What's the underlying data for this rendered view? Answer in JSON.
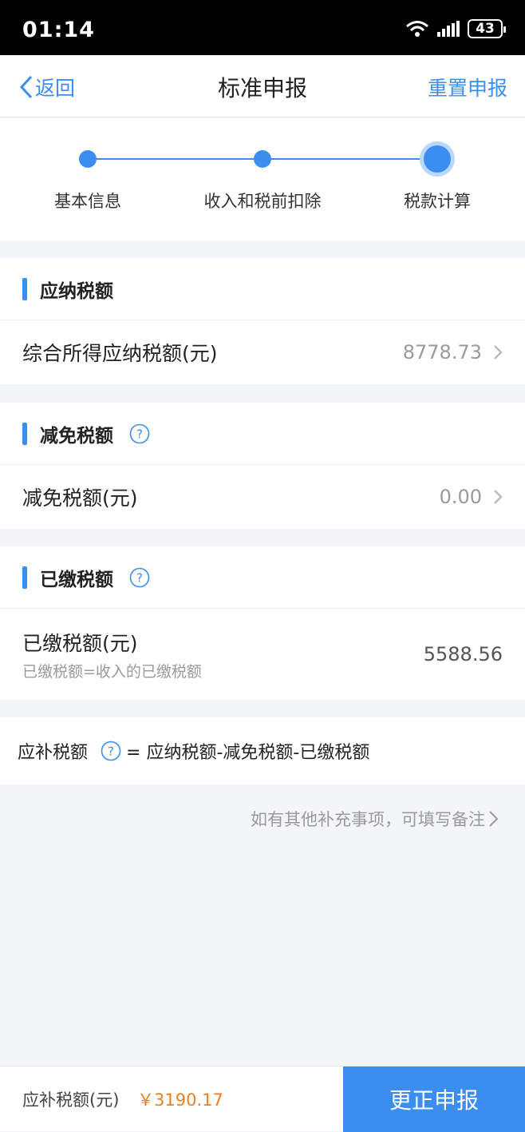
{
  "status_bar": {
    "time": "01:14",
    "battery": "43"
  },
  "nav": {
    "back_label": "返回",
    "title": "标准申报",
    "reset_label": "重置申报"
  },
  "steps": [
    {
      "label": "基本信息"
    },
    {
      "label": "收入和税前扣除"
    },
    {
      "label": "税款计算"
    }
  ],
  "sections": {
    "payable": {
      "title": "应纳税额",
      "row_label": "综合所得应纳税额(元)",
      "row_value": "8778.73"
    },
    "reduction": {
      "title": "减免税额",
      "row_label": "减免税额(元)",
      "row_value": "0.00"
    },
    "paid": {
      "title": "已缴税额",
      "row_label": "已缴税额(元)",
      "row_sub": "已缴税额=收入的已缴税额",
      "row_value": "5588.56"
    }
  },
  "formula": {
    "term": "应补税额",
    "expression": "= 应纳税额-减免税额-已缴税额"
  },
  "remark": {
    "label": "如有其他补充事项，可填写备注"
  },
  "footer": {
    "label": "应补税额(元)",
    "amount": "￥3190.17",
    "submit_label": "更正申报"
  },
  "colors": {
    "accent": "#3b8ef0",
    "amount": "#e8811f"
  }
}
